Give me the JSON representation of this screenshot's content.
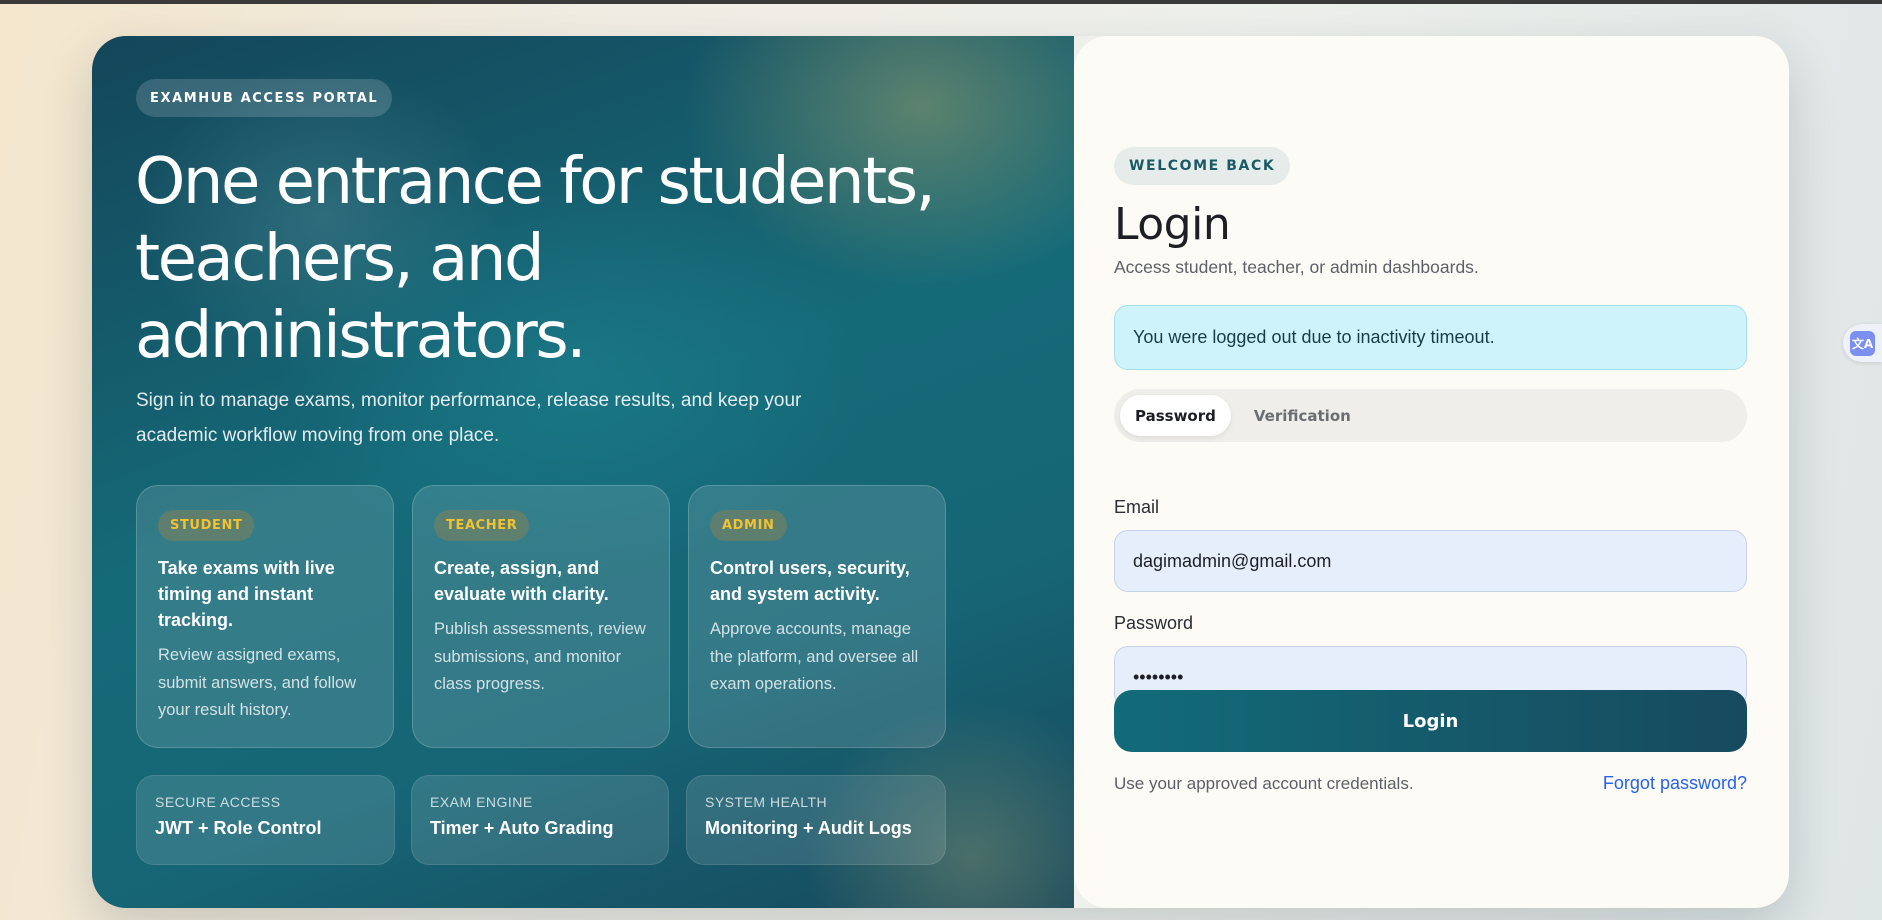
{
  "hero": {
    "portal_badge": "EXAMHUB ACCESS PORTAL",
    "headline": "One entrance for students, teachers, and administrators.",
    "subtitle": "Sign in to manage exams, monitor performance, release results, and keep your academic workflow moving from one place.",
    "roles": [
      {
        "badge": "STUDENT",
        "title": "Take exams with live timing and instant tracking.",
        "text": "Review assigned exams, submit answers, and follow your result history."
      },
      {
        "badge": "TEACHER",
        "title": "Create, assign, and evaluate with clarity.",
        "text": "Publish assessments, review submissions, and monitor class progress."
      },
      {
        "badge": "ADMIN",
        "title": "Control users, security, and system activity.",
        "text": "Approve accounts, manage the platform, and oversee all exam operations."
      }
    ],
    "stats": [
      {
        "label": "SECURE ACCESS",
        "value": "JWT + Role Control"
      },
      {
        "label": "EXAM ENGINE",
        "value": "Timer + Auto Grading"
      },
      {
        "label": "SYSTEM HEALTH",
        "value": "Monitoring + Audit Logs"
      }
    ]
  },
  "login": {
    "welcome_badge": "WELCOME BACK",
    "title": "Login",
    "description": "Access student, teacher, or admin dashboards.",
    "alert": "You were logged out due to inactivity timeout.",
    "tabs": [
      {
        "label": "Password",
        "active": true
      },
      {
        "label": "Verification",
        "active": false
      }
    ],
    "email_label": "Email",
    "email_value": "dagimadmin@gmail.com",
    "password_label": "Password",
    "password_value": "password",
    "submit_label": "Login",
    "hint": "Use your approved account credentials.",
    "forgot_label": "Forgot password?"
  },
  "extension": {
    "icon": "translate-icon"
  },
  "colors": {
    "accent": "#126b79",
    "link": "#2563eb",
    "role_badge": "#f1c232",
    "alert_bg": "#cff3fa"
  }
}
